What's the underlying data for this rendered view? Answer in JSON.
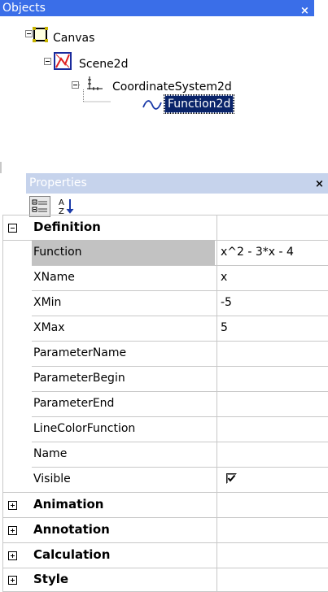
{
  "objects_panel": {
    "title": "Objects",
    "close_glyph": "×",
    "tree": [
      {
        "label": "Canvas",
        "icon": "canvas-icon"
      },
      {
        "label": "Scene2d",
        "icon": "scene2d-icon"
      },
      {
        "label": "CoordinateSystem2d",
        "icon": "coordinate-system-icon"
      },
      {
        "label": "Function2d",
        "icon": "function-curve-icon",
        "selected": true
      }
    ]
  },
  "properties_panel": {
    "title": "Properties",
    "close_glyph": "×",
    "toolbar": {
      "categorized_icon": "categorized-view-icon",
      "alphabetical_icon": "alphabetical-sort-icon"
    },
    "categories": [
      {
        "name": "Definition",
        "expanded": true,
        "properties": [
          {
            "name": "Function",
            "value": "x^2 - 3*x - 4",
            "selected": true
          },
          {
            "name": "XName",
            "value": "x"
          },
          {
            "name": "XMin",
            "value": "-5"
          },
          {
            "name": "XMax",
            "value": "5"
          },
          {
            "name": "ParameterName",
            "value": ""
          },
          {
            "name": "ParameterBegin",
            "value": ""
          },
          {
            "name": "ParameterEnd",
            "value": ""
          },
          {
            "name": "LineColorFunction",
            "value": ""
          },
          {
            "name": "Name",
            "value": ""
          },
          {
            "name": "Visible",
            "value": "",
            "checked": true
          }
        ]
      },
      {
        "name": "Animation",
        "expanded": false
      },
      {
        "name": "Annotation",
        "expanded": false
      },
      {
        "name": "Calculation",
        "expanded": false
      },
      {
        "name": "Style",
        "expanded": false
      }
    ]
  },
  "colors": {
    "objects_title_bg": "#3a6ee8",
    "properties_title_bg": "#c6d3ec",
    "selection_bg": "#0a246a",
    "grid_line": "#c8c8c8",
    "selected_row_bg": "#c2c2c2"
  }
}
